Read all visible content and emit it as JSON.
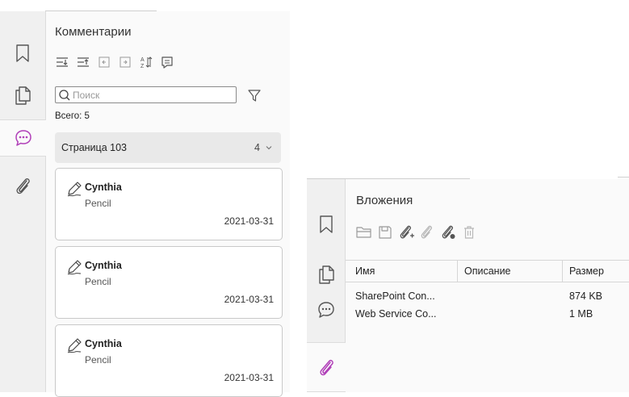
{
  "comments_panel": {
    "title": "Комментарии",
    "search_placeholder": "Поиск",
    "total": "Всего: 5",
    "group": {
      "label": "Страница 103",
      "count": "4"
    },
    "toolbar_icons": [
      "expand-all-icon",
      "collapse-all-icon",
      "previous-icon",
      "next-icon",
      "sort-icon",
      "comment-icon"
    ],
    "rail_icons": [
      "bookmark-icon",
      "pages-icon",
      "comments-icon",
      "attachment-icon"
    ],
    "cards": [
      {
        "author": "Cynthia",
        "type": "Pencil",
        "date": "2021-03-31"
      },
      {
        "author": "Cynthia",
        "type": "Pencil",
        "date": "2021-03-31"
      },
      {
        "author": "Cynthia",
        "type": "Pencil",
        "date": "2021-03-31"
      }
    ]
  },
  "attachments_panel": {
    "title": "Вложения",
    "toolbar_icons": [
      "open-icon",
      "save-icon",
      "add-attachment-icon",
      "edit-attachment-icon",
      "attachment-settings-icon",
      "delete-icon"
    ],
    "columns": [
      "Имя",
      "Описание",
      "Размер"
    ],
    "rows": [
      {
        "name": "SharePoint Con...",
        "description": "",
        "size": "874 KB"
      },
      {
        "name": "Web Service Co...",
        "description": "",
        "size": "1 MB"
      }
    ]
  },
  "colors": {
    "accent": "#b03fb8",
    "icon": "#555555",
    "disabled_icon": "#b8b8b8"
  }
}
